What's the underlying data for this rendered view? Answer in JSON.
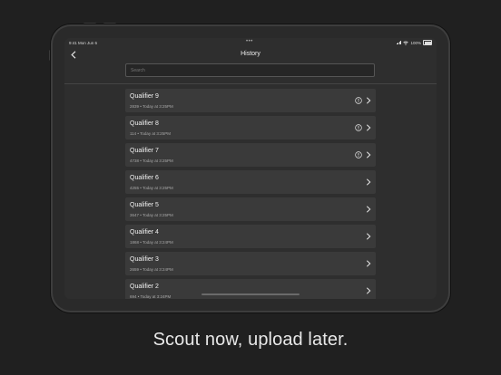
{
  "status": {
    "time": "9:41",
    "date": "Mon Jun 6",
    "dots": "•••",
    "battery": "100%"
  },
  "nav": {
    "title": "History"
  },
  "search": {
    "placeholder": "Search"
  },
  "items": [
    {
      "title": "Qualifier 9",
      "sub": "2839 • Today at 3:25PM",
      "alert": true
    },
    {
      "title": "Qualifier 8",
      "sub": "114 • Today at 3:25PM",
      "alert": true
    },
    {
      "title": "Qualifier 7",
      "sub": "4738 • Today at 3:25PM",
      "alert": true
    },
    {
      "title": "Qualifier 6",
      "sub": "4255 • Today at 3:25PM",
      "alert": false
    },
    {
      "title": "Qualifier 5",
      "sub": "3647 • Today at 3:25PM",
      "alert": false
    },
    {
      "title": "Qualifier 4",
      "sub": "1868 • Today at 3:24PM",
      "alert": false
    },
    {
      "title": "Qualifier 3",
      "sub": "2659 • Today at 3:24PM",
      "alert": false
    },
    {
      "title": "Qualifier 2",
      "sub": "694 • Today at 3:24PM",
      "alert": false
    }
  ],
  "caption": "Scout now, upload later.",
  "colors": {
    "background": "#202020",
    "screen": "#2e2e2e",
    "row": "#3a3a3a",
    "text": "#f0f0f0"
  }
}
